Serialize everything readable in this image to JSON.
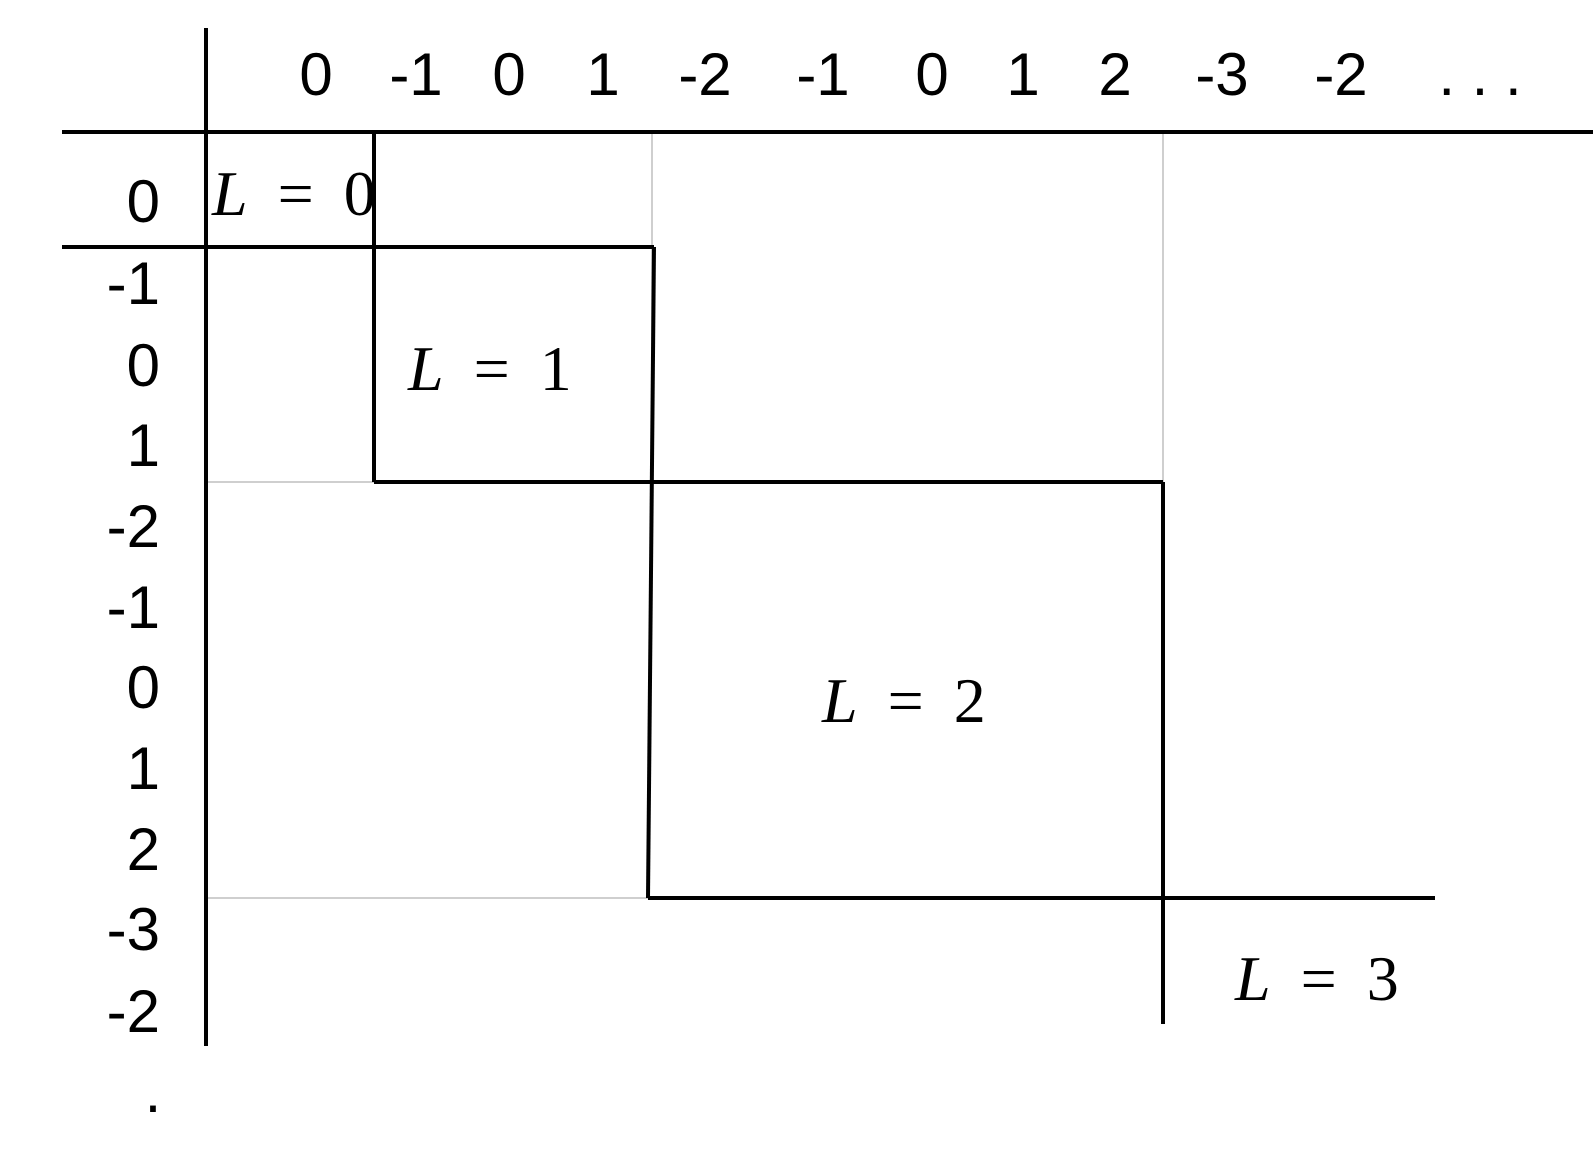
{
  "column_header": {
    "ticks": [
      "0",
      "-1",
      "0",
      "1",
      "-2",
      "-1",
      "0",
      "1",
      "2",
      "-3",
      "-2"
    ],
    "continuation": ". . ."
  },
  "row_header": {
    "ticks": [
      "0",
      "-1",
      "0",
      "1",
      "-2",
      "-1",
      "0",
      "1",
      "2",
      "-3",
      "-2"
    ],
    "continuation": "."
  },
  "blocks": [
    {
      "variable": "L",
      "relation": "=",
      "value": "0"
    },
    {
      "variable": "L",
      "relation": "=",
      "value": "1"
    },
    {
      "variable": "L",
      "relation": "=",
      "value": "2"
    },
    {
      "variable": "L",
      "relation": "=",
      "value": "3"
    }
  ],
  "colors": {
    "line": "#000000",
    "faint_line": "#cfcfcf",
    "background": "#ffffff"
  }
}
